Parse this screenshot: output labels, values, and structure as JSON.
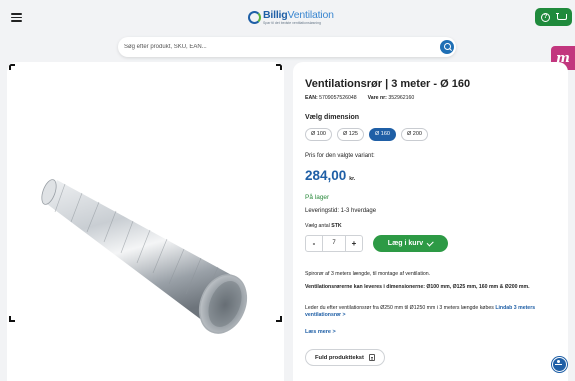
{
  "header": {
    "brand_prefix": "Billig",
    "brand_suffix": "Ventilation",
    "tagline": "Spar til det bedste ventilationsløsning"
  },
  "search": {
    "placeholder": "Søg efter produkt, SKU, EAN..."
  },
  "side_tab": {
    "letter": "m"
  },
  "product": {
    "title": "Ventilationsrør | 3 meter - Ø 160",
    "ean_label": "EAN:",
    "ean_value": "5709057526048",
    "item_label": "Vare nr:",
    "item_value": "352962160",
    "dimension_label": "Vælg dimension",
    "dimensions": [
      {
        "label": "Ø 100",
        "selected": false
      },
      {
        "label": "Ø 125",
        "selected": false
      },
      {
        "label": "Ø 160",
        "selected": true
      },
      {
        "label": "Ø 200",
        "selected": false
      }
    ],
    "price_label": "Pris for den valgte variant:",
    "price": "284,00",
    "currency": "kr.",
    "stock": "På lager",
    "lead_time": "Leveringstid: 1-3 hverdage",
    "qty_label": "Vælg antal",
    "qty_unit": "STK",
    "qty_value": "7",
    "minus": "-",
    "plus": "+",
    "add_to_cart": "Læg i kurv",
    "desc1": "Spirorør af 3 meters længde, til montage af ventilation.",
    "desc2": "Ventilationsrørerne kan leveres i dimensionerne: Ø100 mm, Ø125 mm, 160 mm & Ø200 mm.",
    "desc3": "Leder du efter ventilationsrør fra Ø250 mm til Ø1250 mm i 3 meters længde købes",
    "desc3_link": "Lindab 3 meters ventilationsrør >",
    "read_more": "Læs mere >",
    "full_text_button": "Fuld produkttekst"
  },
  "colors": {
    "brand_blue": "#1f5fa6",
    "green": "#2d9a45",
    "side_tab": "#c2367e"
  }
}
